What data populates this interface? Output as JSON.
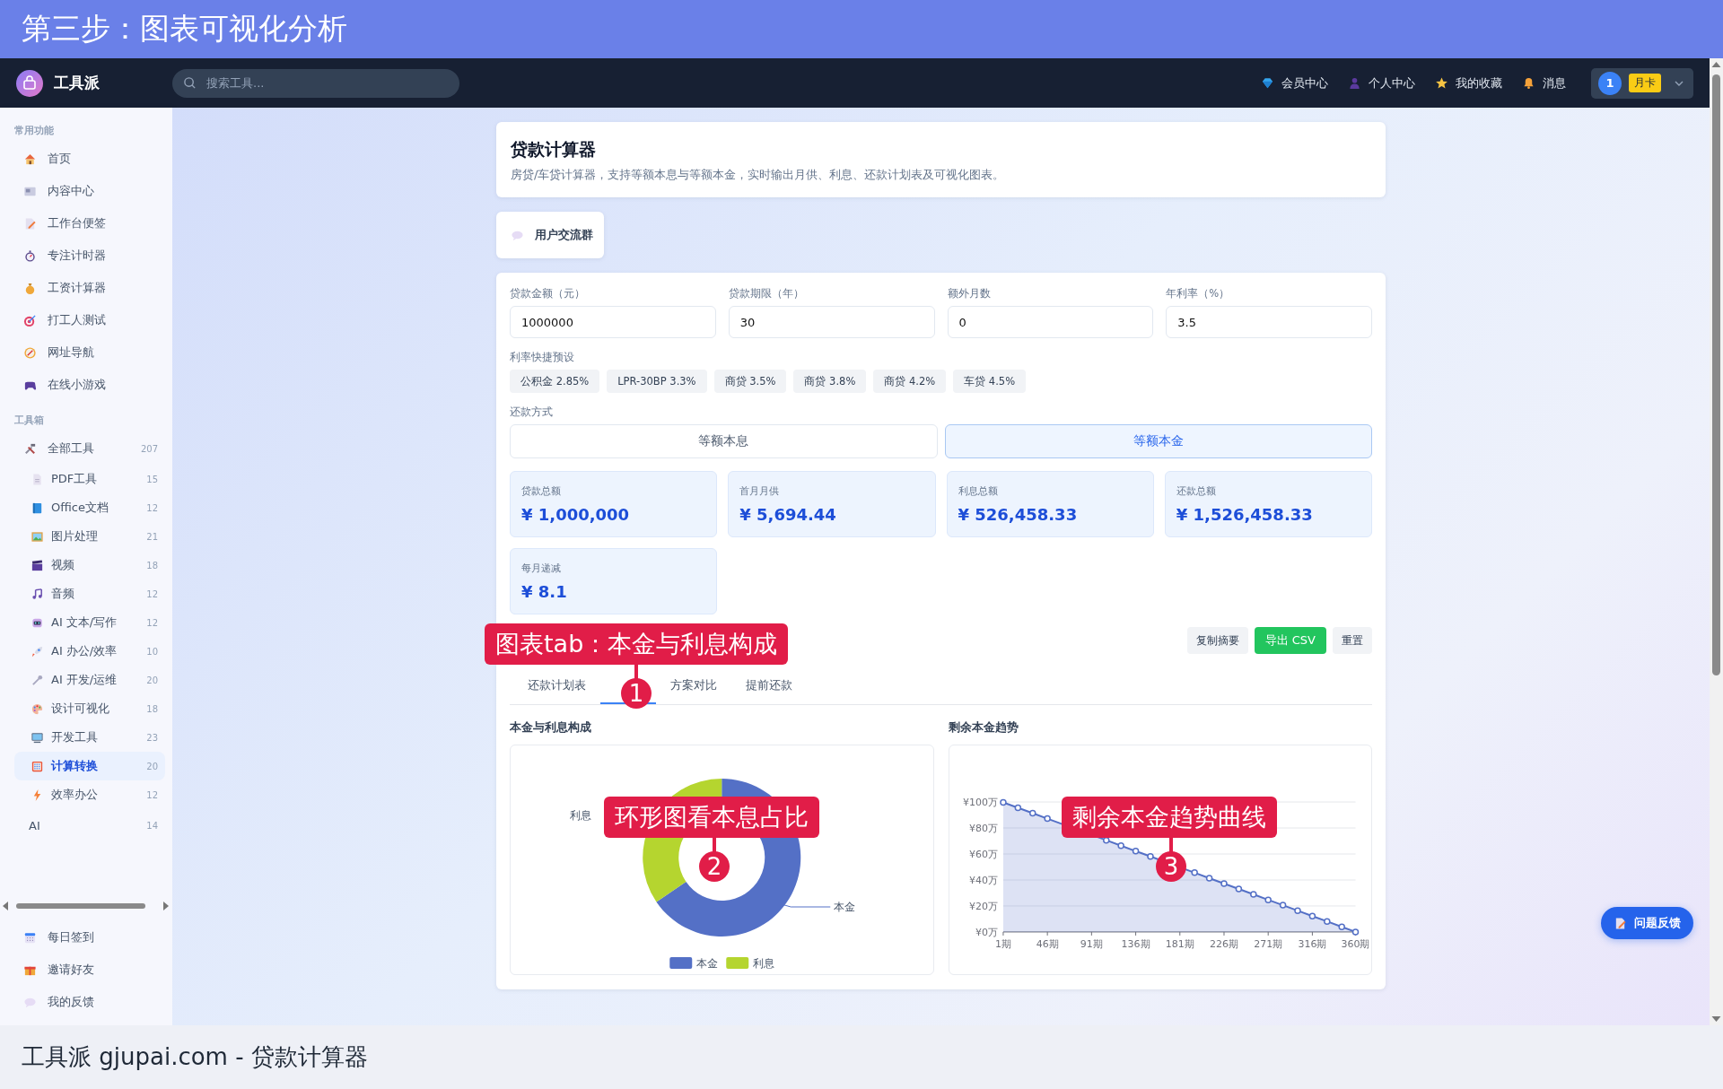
{
  "banner": {
    "title": "第三步：图表可视化分析"
  },
  "topbar": {
    "brand": "工具派",
    "search": {
      "placeholder": "搜索工具..."
    },
    "links": [
      "会员中心",
      "个人中心",
      "我的收藏",
      "消息"
    ],
    "user": {
      "avatar": "1",
      "plan": "月卡"
    }
  },
  "sidebar": {
    "sections": [
      {
        "title": "常用功能",
        "items": [
          {
            "label": "首页"
          },
          {
            "label": "内容中心"
          },
          {
            "label": "工作台便签"
          },
          {
            "label": "专注计时器"
          },
          {
            "label": "工资计算器"
          },
          {
            "label": "打工人测试"
          },
          {
            "label": "网址导航"
          },
          {
            "label": "在线小游戏"
          }
        ]
      },
      {
        "title": "工具箱",
        "items": [
          {
            "label": "全部工具",
            "count": "207",
            "selected": false,
            "children": [
              {
                "label": "PDF工具",
                "count": "15",
                "selected": false
              },
              {
                "label": "Office文档",
                "count": "12",
                "selected": false
              },
              {
                "label": "图片处理",
                "count": "21",
                "selected": false
              },
              {
                "label": "视频",
                "count": "18",
                "selected": false
              },
              {
                "label": "音频",
                "count": "12",
                "selected": false
              },
              {
                "label": "AI 文本/写作",
                "count": "12",
                "selected": false
              },
              {
                "label": "AI 办公/效率",
                "count": "10",
                "selected": false
              },
              {
                "label": "AI 开发/运维",
                "count": "20",
                "selected": false
              },
              {
                "label": "设计可视化",
                "count": "18",
                "selected": false
              },
              {
                "label": "开发工具",
                "count": "23",
                "selected": false
              },
              {
                "label": "计算转换",
                "count": "20",
                "selected": true
              },
              {
                "label": "效率办公",
                "count": "12",
                "selected": false
              }
            ]
          },
          {
            "label": "AI",
            "count": "14",
            "selected": false
          }
        ]
      }
    ],
    "bottom_items": [
      "每日签到",
      "邀请好友",
      "我的反馈"
    ]
  },
  "tool": {
    "title": "贷款计算器",
    "description": "房贷/车贷计算器，支持等额本息与等额本金，实时输出月供、利息、还款计划表及可视化图表。"
  },
  "group_button": "用户交流群",
  "form": {
    "fields": [
      {
        "label": "贷款金额（元）",
        "value": "1000000"
      },
      {
        "label": "贷款期限（年）",
        "value": "30"
      },
      {
        "label": "额外月数",
        "value": "0"
      },
      {
        "label": "年利率（%）",
        "value": "3.5"
      }
    ],
    "presets_label": "利率快捷预设",
    "presets": [
      "公积金 2.85%",
      "LPR-30BP 3.3%",
      "商贷 3.5%",
      "商贷 3.8%",
      "商贷 4.2%",
      "车贷 4.5%"
    ],
    "method_label": "还款方式",
    "methods": [
      {
        "label": "等额本息",
        "selected": false
      },
      {
        "label": "等额本金",
        "selected": true
      }
    ]
  },
  "stats": [
    {
      "label": "贷款总额",
      "value": "¥ 1,000,000"
    },
    {
      "label": "首月月供",
      "value": "¥ 5,694.44"
    },
    {
      "label": "利息总额",
      "value": "¥ 526,458.33"
    },
    {
      "label": "还款总额",
      "value": "¥ 1,526,458.33"
    },
    {
      "label": "每月递减",
      "value": "¥ 8.1"
    }
  ],
  "actions": [
    {
      "label": "复制摘要",
      "kind": "plain"
    },
    {
      "label": "导出 CSV",
      "kind": "primary"
    },
    {
      "label": "重置",
      "kind": "plain"
    }
  ],
  "tabs": [
    {
      "label": "还款计划表",
      "selected": false
    },
    {
      "selected": true
    },
    {
      "label": "方案对比",
      "selected": false
    },
    {
      "label": "提前还款",
      "selected": false
    }
  ],
  "charts": [
    {
      "title": "本金与利息构成",
      "legend": [
        "本金",
        "利息"
      ],
      "chart_data": {
        "type": "donut",
        "categories": [
          "本金",
          "利息"
        ],
        "values": [
          65.5,
          34.5
        ]
      }
    },
    {
      "title": "剩余本金趋势",
      "chart_data": {
        "type": "area",
        "x": [
          1,
          16,
          31,
          46,
          106,
          121,
          136,
          151,
          196,
          211,
          226,
          241,
          256,
          271,
          286,
          301,
          316,
          331,
          346,
          360
        ],
        "series": [
          {
            "color": "#5470c6",
            "values": [
              99.7,
              95.6,
              91.4,
              87.2,
              70.6,
              66.4,
              62.2,
              58.1,
              45.6,
              41.4,
              37.2,
              33.1,
              28.9,
              24.7,
              20.6,
              16.4,
              12.2,
              8.1,
              3.9,
              0
            ]
          }
        ],
        "xlim": [
          1,
          360
        ],
        "ylim": [
          0,
          100
        ],
        "grid": true,
        "yticks": [
          {
            "value": 0,
            "label": "¥0万"
          },
          {
            "value": 20,
            "label": "¥20万"
          },
          {
            "value": 40,
            "label": "¥40万"
          },
          {
            "value": 60,
            "label": "¥60万"
          },
          {
            "value": 80,
            "label": "¥80万"
          },
          {
            "value": 100,
            "label": "¥100万"
          }
        ],
        "xticks": [
          {
            "value": 1,
            "label": "1期"
          },
          {
            "value": 46,
            "label": "46期"
          },
          {
            "value": 91,
            "label": "91期"
          },
          {
            "value": 136,
            "label": "136期"
          },
          {
            "value": 181,
            "label": "181期"
          },
          {
            "value": 226,
            "label": "226期"
          },
          {
            "value": 271,
            "label": "271期"
          },
          {
            "value": 316,
            "label": "316期"
          },
          {
            "value": 360,
            "label": "360期"
          }
        ]
      }
    }
  ],
  "feedback_button": "问题反馈",
  "callouts": [
    {
      "number": "1",
      "text": "图表tab：本金与利息构成"
    },
    {
      "number": "2",
      "text": "环形图看本息占比"
    },
    {
      "number": "3",
      "text": "剩余本金趋势曲线"
    }
  ],
  "footer": {
    "caption": "工具派 gjupai.com - 贷款计算器"
  }
}
